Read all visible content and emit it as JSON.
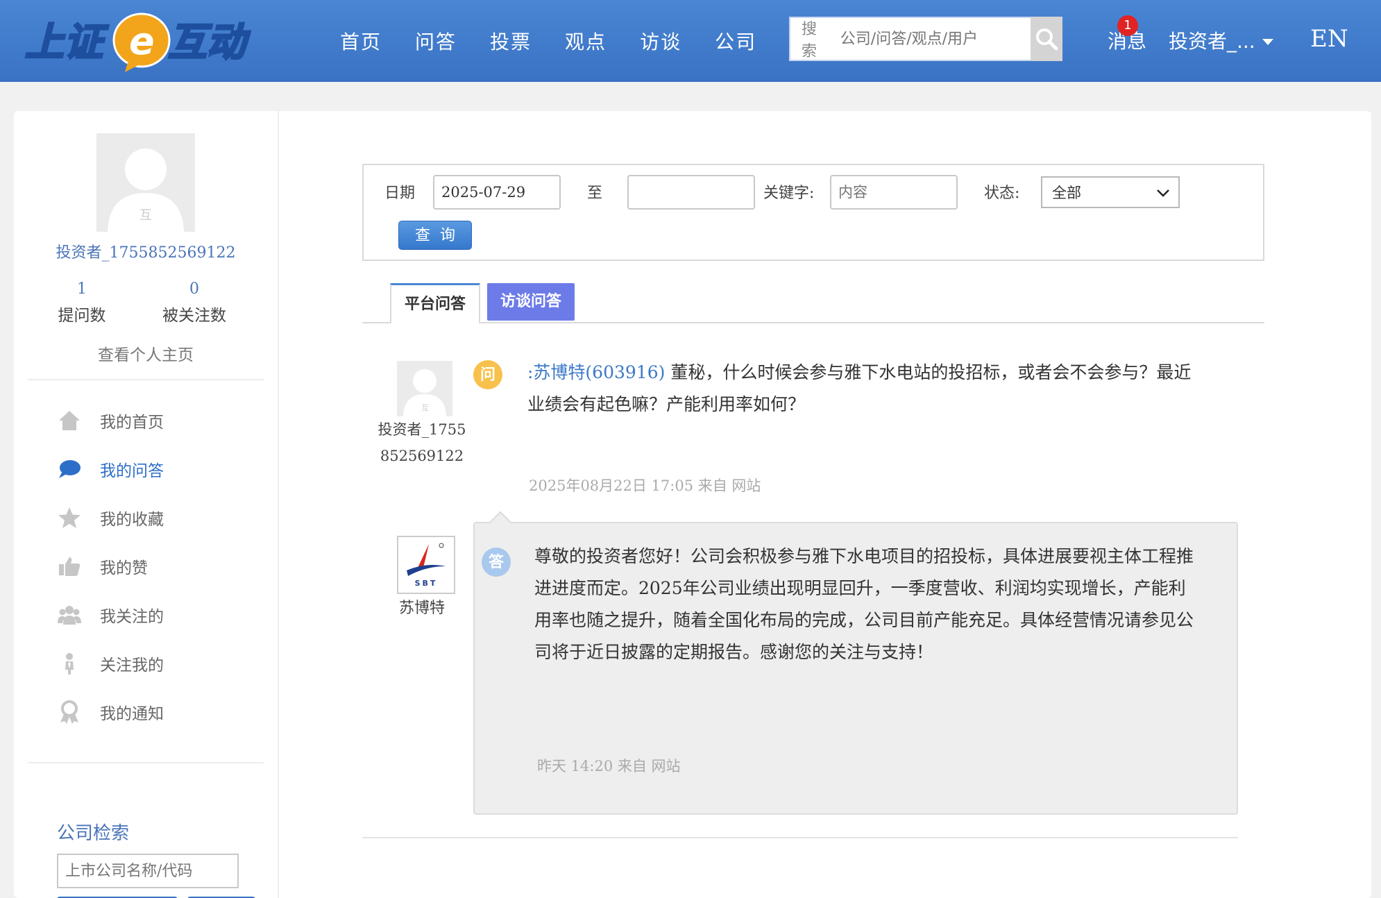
{
  "header": {
    "logo_text": "上证e互动",
    "nav": [
      "首页",
      "问答",
      "投票",
      "观点",
      "访谈",
      "公司"
    ],
    "search_label": "搜索",
    "search_placeholder": "公司/问答/观点/用户",
    "messages_label": "消息",
    "messages_count": "1",
    "user_menu_label": "投资者_...",
    "lang_label": "EN"
  },
  "sidebar": {
    "avatar_char": "互",
    "user_name": "投资者_1755852569122",
    "stats": [
      {
        "num": "1",
        "label": "提问数"
      },
      {
        "num": "0",
        "label": "被关注数"
      }
    ],
    "profile_link": "查看个人主页",
    "menu": [
      {
        "label": "我的首页",
        "icon": "home-icon",
        "active": false
      },
      {
        "label": "我的问答",
        "icon": "chat-bubble-icon",
        "active": true
      },
      {
        "label": "我的收藏",
        "icon": "star-icon",
        "active": false
      },
      {
        "label": "我的赞",
        "icon": "thumbs-up-icon",
        "active": false
      },
      {
        "label": "我关注的",
        "icon": "people-icon",
        "active": false
      },
      {
        "label": "关注我的",
        "icon": "follower-icon",
        "active": false
      },
      {
        "label": "我的通知",
        "icon": "notification-icon",
        "active": false
      }
    ],
    "company_search_title": "公司检索",
    "company_search_placeholder": "上市公司名称/代码"
  },
  "filter": {
    "date_label": "日期",
    "date_from": "2025-07-29",
    "to_label": "至",
    "date_to": "",
    "keyword_label": "关键字:",
    "keyword_placeholder": "内容",
    "status_label": "状态:",
    "status_value": "全部",
    "query_button": "查询"
  },
  "tabs": {
    "platform": "平台问答",
    "interview": "访谈问答"
  },
  "question": {
    "avatar_char": "互",
    "user_line1": "投资者_1755",
    "user_line2": "852569122",
    "badge": "问",
    "mention": ":苏博特(603916)",
    "text": "董秘，什么时候会参与雅下水电站的投招标，或者会不会参与？最近业绩会有起色嘛？产能利用率如何？",
    "meta": "2025年08月22日 17:05 来自 网站"
  },
  "answer": {
    "company": "苏博特",
    "logo_text": "SBT",
    "badge": "答",
    "text": "尊敬的投资者您好！公司会积极参与雅下水电项目的招投标，具体进展要视主体工程推进进度而定。2025年公司业绩出现明显回升，一季度营收、利润均实现增长，产能利用率也随之提升，随着全国化布局的完成，公司目前产能充足。具体经营情况请参见公司将于近日披露的定期报告。感谢您的关注与支持！",
    "meta": "昨天 14:20 来自 网站"
  },
  "colors": {
    "header": "#3a72c4",
    "link": "#4a74b8",
    "tab_active_bg": "#6d7be8",
    "question_badge": "#f7c14b",
    "answer_badge": "#a9c8ee"
  }
}
